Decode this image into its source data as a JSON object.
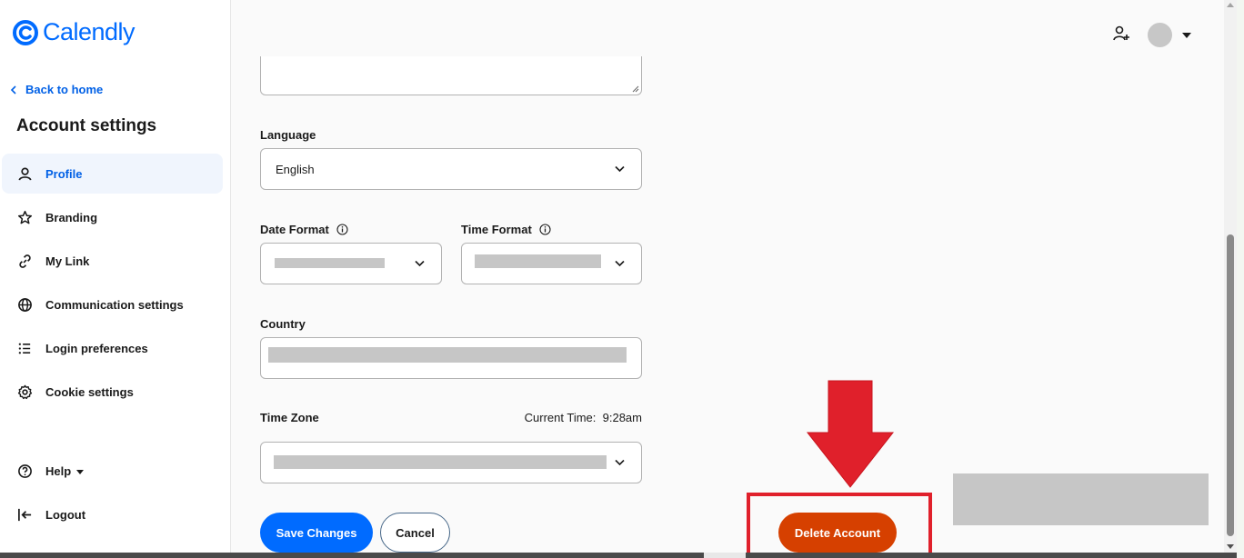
{
  "brand": {
    "name": "Calendly",
    "color": "#006bff"
  },
  "sidebar": {
    "back_label": "Back to home",
    "title": "Account settings",
    "items": [
      {
        "label": "Profile",
        "icon": "person-icon",
        "active": true
      },
      {
        "label": "Branding",
        "icon": "star-icon",
        "active": false
      },
      {
        "label": "My Link",
        "icon": "link-icon",
        "active": false
      },
      {
        "label": "Communication settings",
        "icon": "globe-icon",
        "active": false
      },
      {
        "label": "Login preferences",
        "icon": "list-icon",
        "active": false
      },
      {
        "label": "Cookie settings",
        "icon": "gear-icon",
        "active": false
      }
    ],
    "help_label": "Help",
    "logout_label": "Logout"
  },
  "form": {
    "language": {
      "label": "Language",
      "value": "English"
    },
    "date_format": {
      "label": "Date Format"
    },
    "time_format": {
      "label": "Time Format"
    },
    "country": {
      "label": "Country"
    },
    "time_zone": {
      "label": "Time Zone",
      "current_time_label": "Current Time:",
      "current_time": "9:28am"
    },
    "save_label": "Save Changes",
    "cancel_label": "Cancel",
    "delete_label": "Delete Account"
  },
  "colors": {
    "primary": "#006bff",
    "danger": "#d64000",
    "highlight": "#e0202b"
  }
}
